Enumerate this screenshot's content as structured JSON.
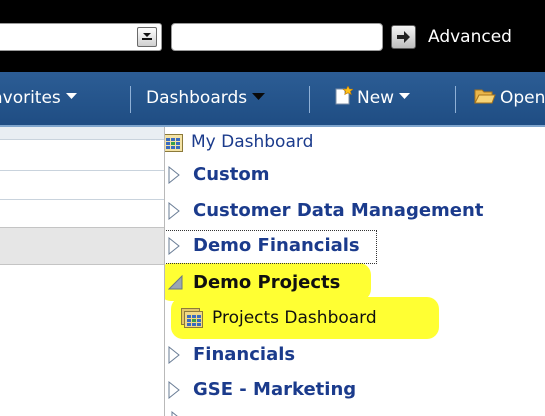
{
  "search": {
    "scope_value": "",
    "query_value": "",
    "query_placeholder": "",
    "advanced_label": "Advanced"
  },
  "nav": {
    "favorites_label": "Favorites",
    "dashboards_label": "Dashboards",
    "new_label": "New",
    "open_label": "Open"
  },
  "dashboards_menu": {
    "items": [
      {
        "label": "My Dashboard",
        "kind": "dashboard"
      },
      {
        "label": "Custom",
        "kind": "folder",
        "expanded": false
      },
      {
        "label": "Customer Data Management",
        "kind": "folder",
        "expanded": false
      },
      {
        "label": "Demo Financials",
        "kind": "folder",
        "expanded": false,
        "focused": true
      },
      {
        "label": "Demo Projects",
        "kind": "folder",
        "expanded": true,
        "highlighted": true
      },
      {
        "label": "Projects Dashboard",
        "kind": "dashboard",
        "highlighted": true
      },
      {
        "label": "Financials",
        "kind": "folder",
        "expanded": false
      },
      {
        "label": "GSE - Marketing",
        "kind": "folder",
        "expanded": false
      }
    ]
  },
  "icons": {
    "dropdown": "chevron-down-icon",
    "go": "arrow-right-icon",
    "dashboard": "dashboard-grid-icon",
    "collapsed_folder": "triangle-right-icon",
    "expanded_folder": "triangle-expanded-icon",
    "new": "new-document-icon",
    "open": "folder-open-icon"
  },
  "colors": {
    "nav_bar": "#24548a",
    "menu_text": "#1b3b8c",
    "highlight": "#ffff33",
    "top_bar": "#000000"
  }
}
